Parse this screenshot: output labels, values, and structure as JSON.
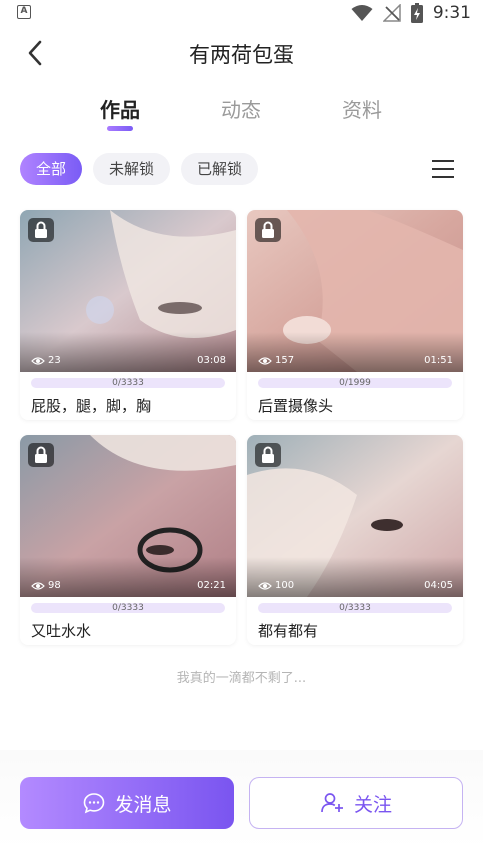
{
  "status_bar": {
    "left_badge": "A",
    "time": "9:31",
    "icons": [
      "wifi-icon",
      "no-signal-icon",
      "battery-charging-icon"
    ]
  },
  "header": {
    "title": "有两荷包蛋",
    "back_icon": "chevron-left-icon"
  },
  "tabs": [
    {
      "label": "作品",
      "active": true
    },
    {
      "label": "动态",
      "active": false
    },
    {
      "label": "资料",
      "active": false
    }
  ],
  "filters": [
    {
      "label": "全部",
      "active": true
    },
    {
      "label": "未解锁",
      "active": false
    },
    {
      "label": "已解锁",
      "active": false
    }
  ],
  "videos": [
    {
      "views": "23",
      "duration": "03:08",
      "progress": "0/3333",
      "progress_value": 0,
      "title": "屁股，腿，脚，胸",
      "locked": true
    },
    {
      "views": "157",
      "duration": "01:51",
      "progress": "0/1999",
      "progress_value": 0,
      "title": "后置摄像头",
      "locked": true
    },
    {
      "views": "98",
      "duration": "02:21",
      "progress": "0/3333",
      "progress_value": 0,
      "title": "又吐水水",
      "locked": true
    },
    {
      "views": "100",
      "duration": "04:05",
      "progress": "0/3333",
      "progress_value": 0,
      "title": "都有都有",
      "locked": true
    }
  ],
  "end_text": "我真的一滴都不剩了...",
  "actions": {
    "message_label": "发消息",
    "follow_label": "关注"
  },
  "colors": {
    "accent": "#7a55f0",
    "accent_light": "#b38aff",
    "progress_bg": "#ece4fb"
  }
}
